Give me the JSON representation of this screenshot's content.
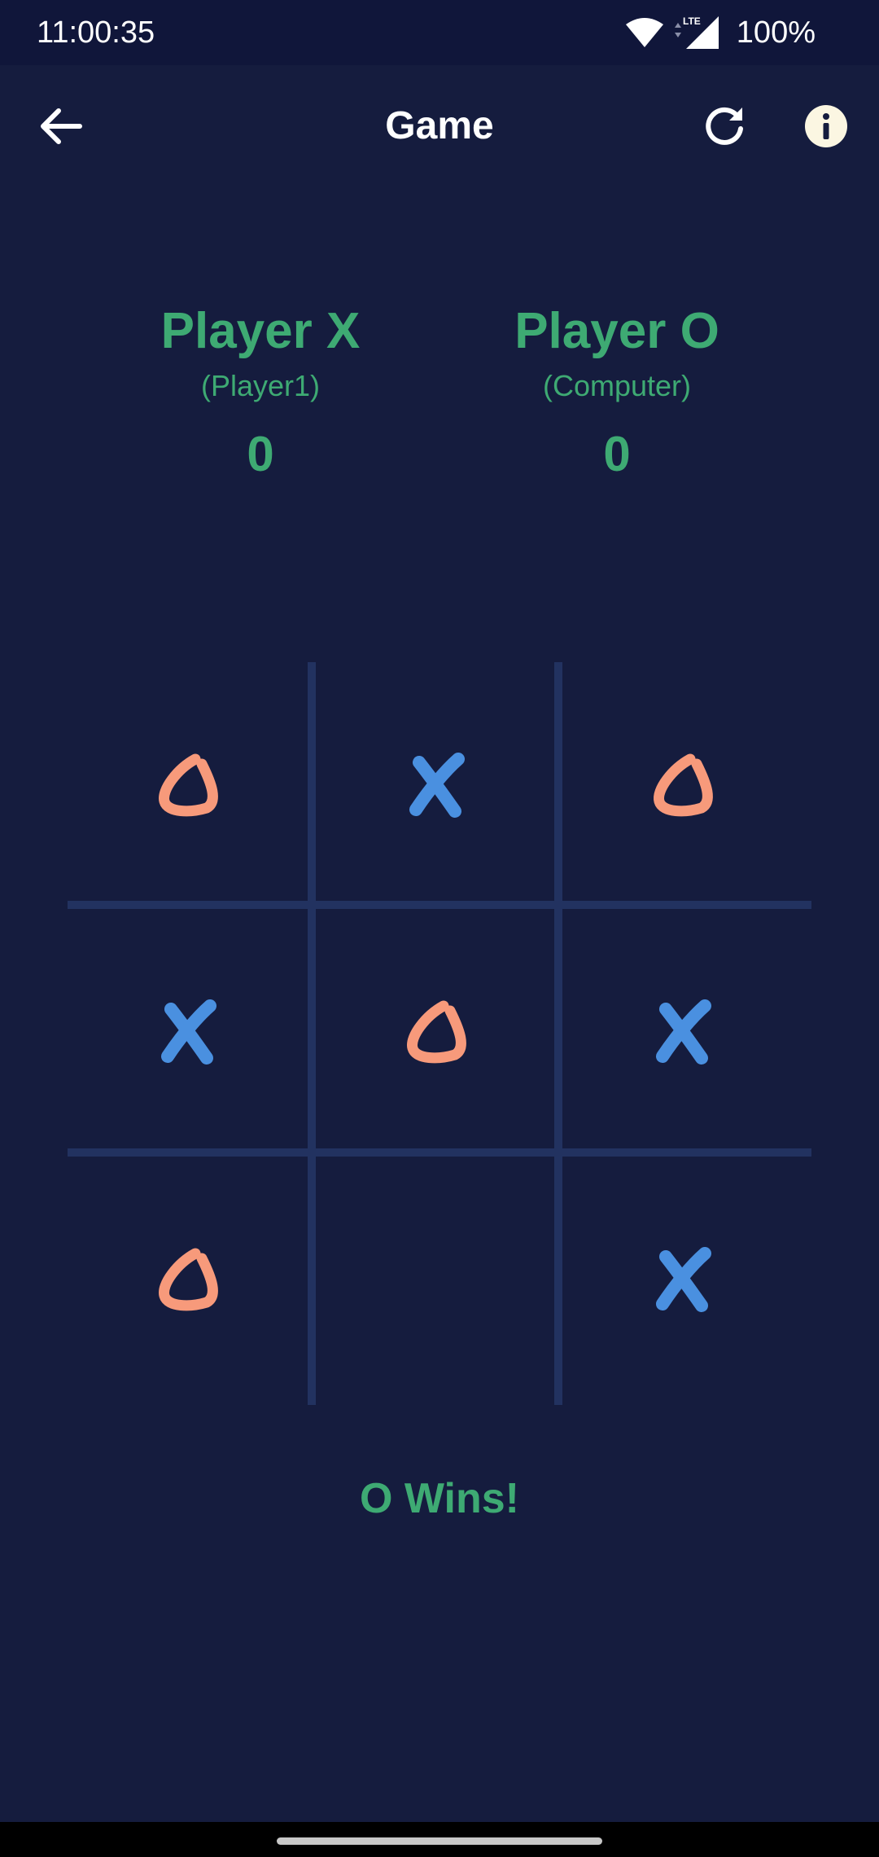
{
  "status_bar": {
    "time": "11:00:35",
    "network": "LTE",
    "battery": "100%"
  },
  "app_bar": {
    "title": "Game",
    "icons": [
      "arrow-back-icon",
      "refresh-icon",
      "info-icon"
    ]
  },
  "players": [
    {
      "name": "Player X",
      "subtitle": "(Player1)",
      "score": "0"
    },
    {
      "name": "Player O",
      "subtitle": "(Computer)",
      "score": "0"
    }
  ],
  "board": {
    "cells": [
      "O",
      "X",
      "O",
      "X",
      "O",
      "X",
      "O",
      "",
      "X"
    ],
    "x_color": "#4a90e0",
    "o_color": "#f79a7b"
  },
  "result": "O Wins!",
  "colors": {
    "background": "#151c3e",
    "status_bar": "#10163a",
    "accent_green": "#3eaa73",
    "grid_line": "#223260"
  }
}
